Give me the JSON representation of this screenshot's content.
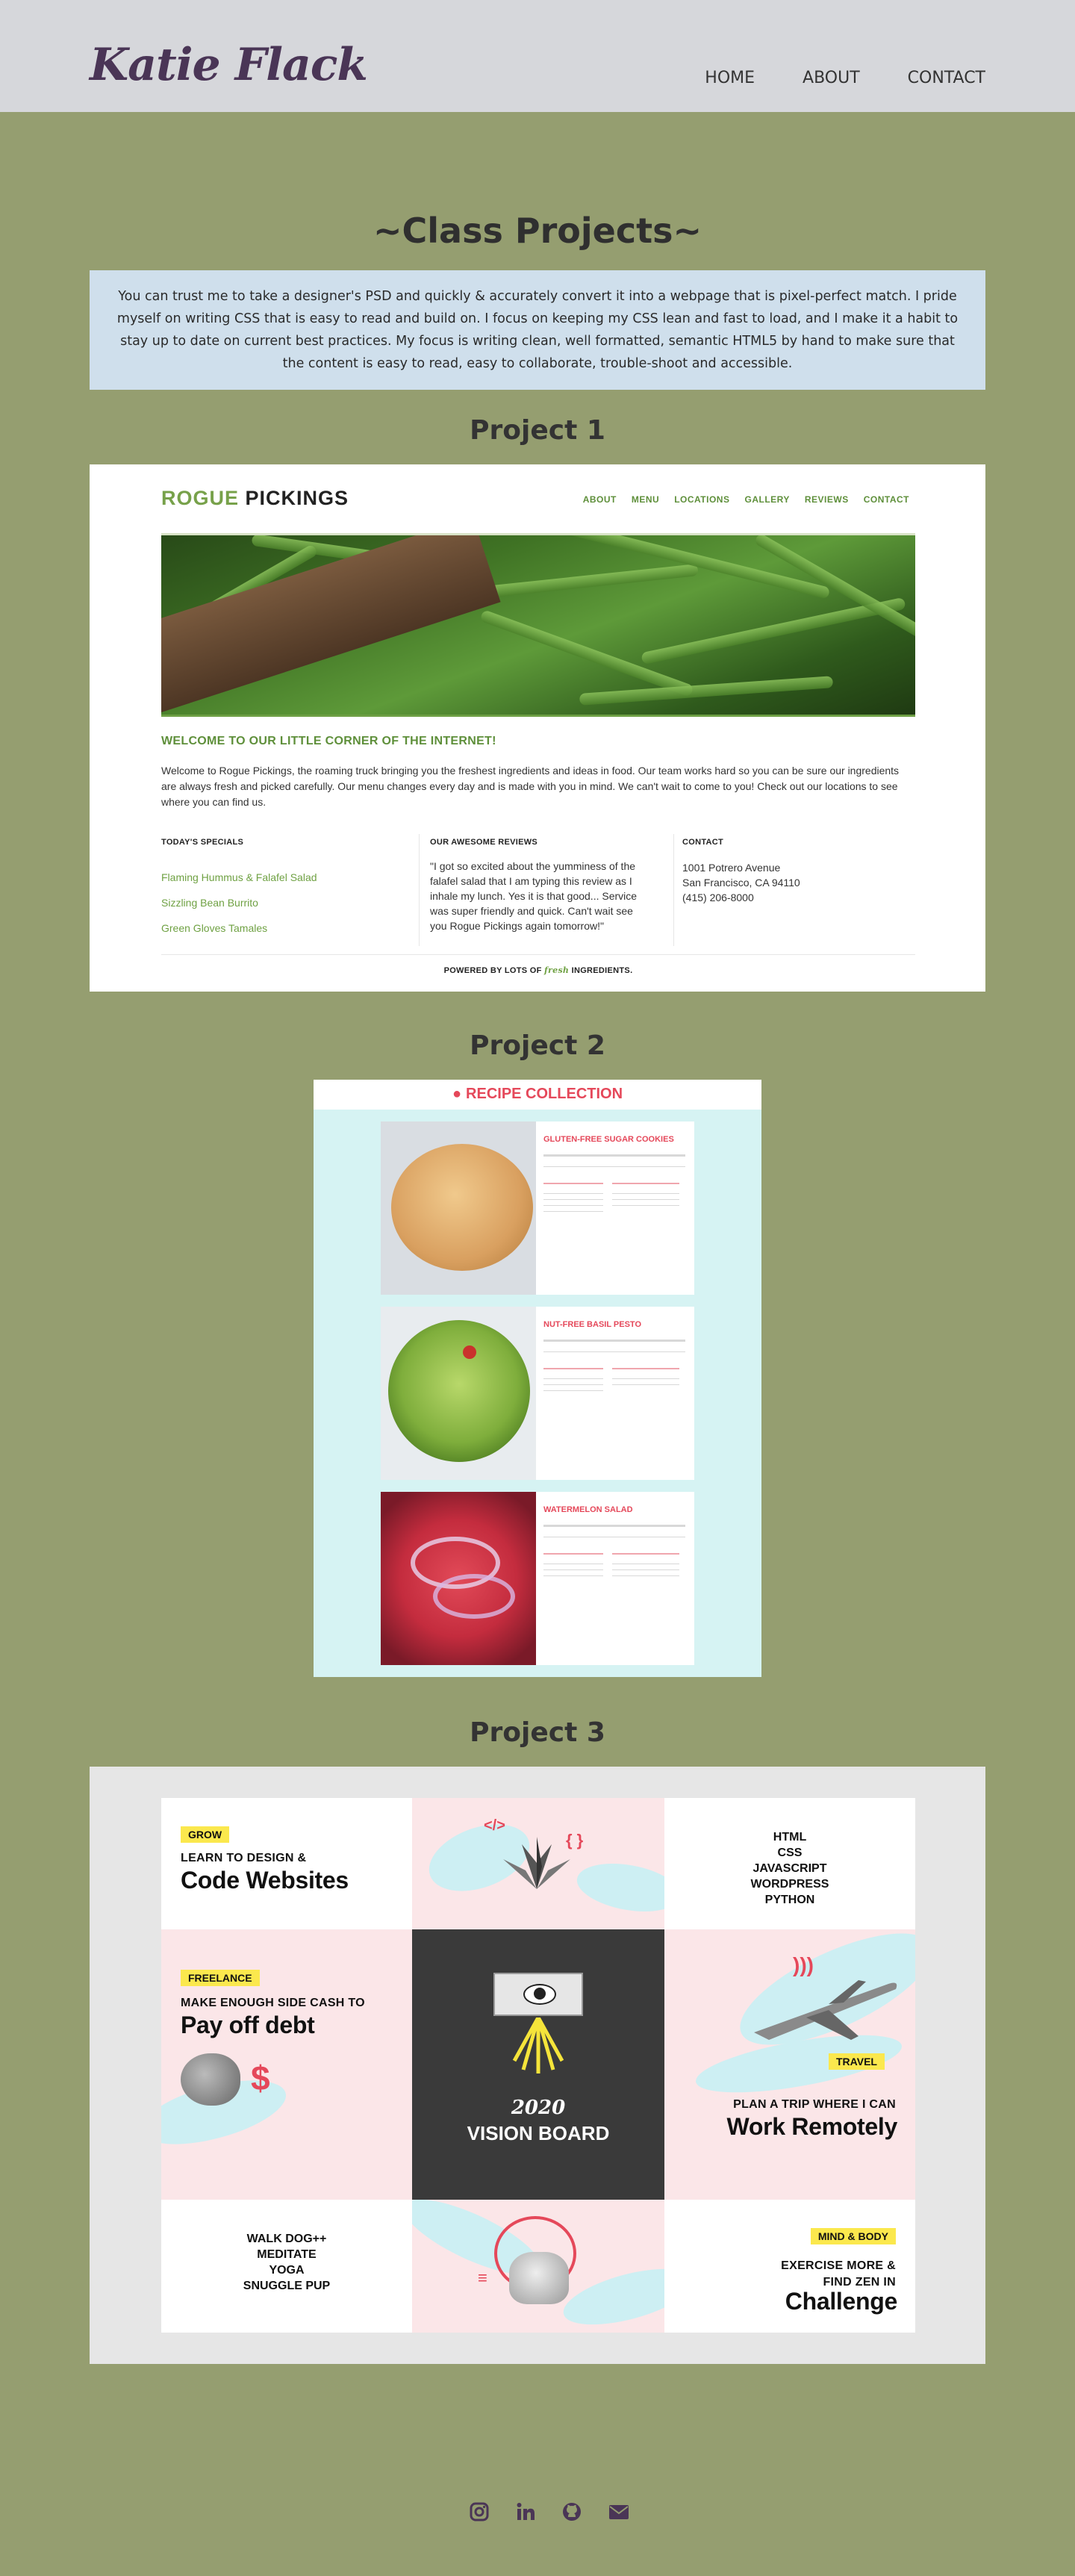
{
  "header": {
    "logo": "Katie Flack",
    "nav": [
      "HOME",
      "ABOUT",
      "CONTACT"
    ]
  },
  "main": {
    "title": "~Class Projects~",
    "intro": "You can trust me to take a designer's PSD and quickly & accurately convert it into a webpage that is pixel-perfect match. I pride myself on writing CSS that is easy to read and build on. I focus on keeping my CSS lean and fast to load, and I make it a habit to stay up to date on current best practices. My focus is writing clean, well formatted, semantic HTML5 by hand to make sure that the content is easy to read, easy to collaborate, trouble-shoot and accessible."
  },
  "project1": {
    "heading": "Project 1",
    "logo_accent": "ROGUE",
    "logo_rest": " PICKINGS",
    "nav": [
      "ABOUT",
      "MENU",
      "LOCATIONS",
      "GALLERY",
      "REVIEWS",
      "CONTACT"
    ],
    "welcome": "WELCOME TO OUR LITTLE CORNER OF THE INTERNET!",
    "text": "Welcome to Rogue Pickings, the roaming truck bringing you the freshest ingredients and ideas in food. Our team works hard so you can be sure our ingredients are always fresh and picked carefully. Our menu changes every day and is made with you in mind. We can't wait to come to you! Check out our locations to see where you can find us.",
    "specials_title": "TODAY'S SPECIALS",
    "specials": [
      "Flaming Hummus & Falafel Salad",
      "Sizzling Bean Burrito",
      "Green Gloves Tamales"
    ],
    "reviews_title": "OUR AWESOME REVIEWS",
    "review": "\"I got so excited about the yumminess of the falafel salad that I am typing this review as I inhale my lunch. Yes it is that good... Service was super friendly and quick. Can't wait see you Rogue Pickings again tomorrow!\"",
    "contact_title": "CONTACT",
    "contact_lines": [
      "1001 Potrero Avenue",
      "San Francisco, CA 94110",
      "(415) 206-8000"
    ],
    "footer_pre": "POWERED BY LOTS OF ",
    "footer_em": "fresh",
    "footer_post": " INGREDIENTS."
  },
  "project2": {
    "heading": "Project 2",
    "title": "RECIPE COLLECTION",
    "recipes": [
      "GLUTEN-FREE SUGAR COOKIES",
      "NUT-FREE BASIL PESTO",
      "WATERMELON SALAD"
    ]
  },
  "project3": {
    "heading": "Project 3",
    "grow_tag": "GROW",
    "grow_small": "LEARN TO DESIGN &",
    "grow_big": "Code Websites",
    "skills": [
      "HTML",
      "CSS",
      "JAVASCRIPT",
      "WORDPRESS",
      "PYTHON"
    ],
    "freelance_tag": "FREELANCE",
    "freelance_small": "MAKE ENOUGH SIDE CASH TO",
    "freelance_big": "Pay off debt",
    "center_year": "2020",
    "center_title": "VISION BOARD",
    "travel_tag": "TRAVEL",
    "travel_small": "PLAN A TRIP WHERE I CAN",
    "travel_big": "Work Remotely",
    "dog_list": [
      "WALK DOG++",
      "MEDITATE",
      "YOGA",
      "SNUGGLE PUP"
    ],
    "mind_tag": "MIND & BODY",
    "mind_small_1": "EXERCISE MORE &",
    "mind_small_2": "FIND ZEN IN",
    "mind_big": "Challenge"
  },
  "footer": {
    "icons": [
      "instagram-icon",
      "linkedin-icon",
      "github-icon",
      "email-icon"
    ]
  },
  "colors": {
    "page_bg": "#959e70",
    "header_bg": "#d6d7db",
    "logo": "#4a3556",
    "intro_bg": "#cfdfec",
    "rogue_green": "#77a14a",
    "recipe_red": "#e5485a",
    "recipe_bg": "#d6f3f3",
    "vision_yellow": "#fbe84d",
    "vision_dark": "#3a3a3a"
  }
}
